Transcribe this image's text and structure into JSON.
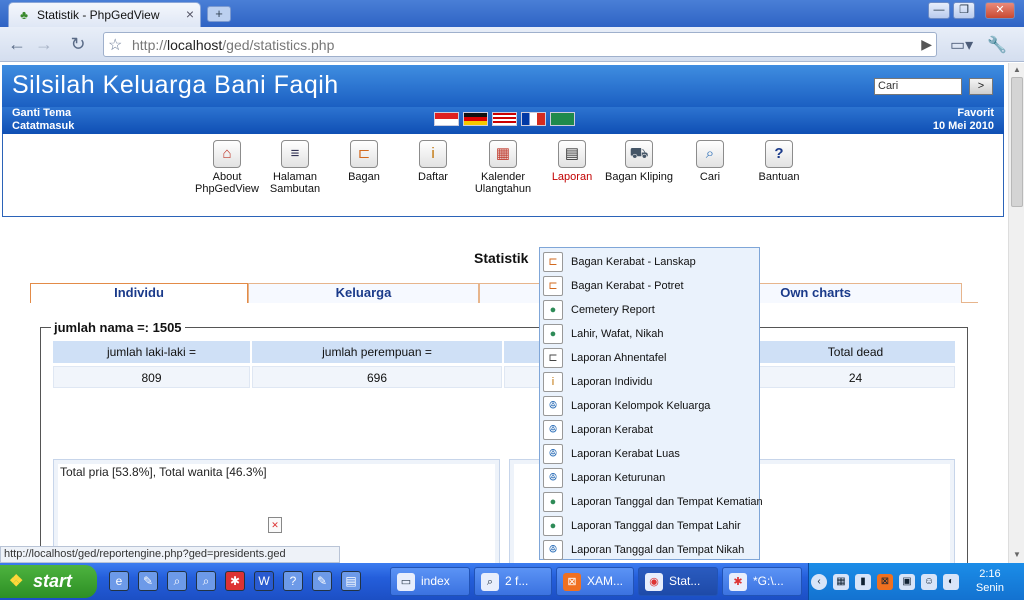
{
  "browser": {
    "tab_title": "Statistik - PhpGedView",
    "url_prefix": "http://",
    "url_host": "localhost",
    "url_path": "/ged/statistics.php",
    "tab_close": "×",
    "new_tab": "+",
    "win_min": "—",
    "win_max": "❐",
    "win_close": "✕"
  },
  "site": {
    "title": "Silsilah Keluarga Bani Faqih",
    "search_placeholder": "Cari",
    "search_button": ">",
    "left_links": [
      "Ganti Tema",
      "Catatmasuk"
    ],
    "right_links": [
      "Favorit",
      "10 Mei 2010"
    ]
  },
  "menu": [
    {
      "label1": "About",
      "label2": "PhpGedView",
      "icon": "⌂"
    },
    {
      "label1": "Halaman",
      "label2": "Sambutan",
      "icon": "≡"
    },
    {
      "label1": "Bagan",
      "label2": "",
      "icon": "⊏"
    },
    {
      "label1": "Daftar",
      "label2": "",
      "icon": "i"
    },
    {
      "label1": "Kalender",
      "label2": "Ulangtahun",
      "icon": "▦"
    },
    {
      "label1": "Laporan",
      "label2": "",
      "icon": "▤"
    },
    {
      "label1": "Bagan Kliping",
      "label2": "",
      "icon": "⛟"
    },
    {
      "label1": "Cari",
      "label2": "",
      "icon": "⌕"
    },
    {
      "label1": "Bantuan",
      "label2": "",
      "icon": "?"
    }
  ],
  "page": {
    "heading": "Statistik",
    "tabs": [
      "Individu",
      "Keluarga",
      "Own charts"
    ],
    "legend": "jumlah nama =: 1505",
    "headers": [
      "jumlah laki-laki =",
      "jumlah perempuan =",
      "Total dead"
    ],
    "values": [
      "809",
      "696",
      "24"
    ],
    "chart_text": "Total pria [53.8%], Total wanita [46.3%]",
    "status_url": "http://localhost/ged/reportengine.php?ged=presidents.ged"
  },
  "dropdown": [
    {
      "label": "Bagan Kerabat - Lanskap",
      "icon": "⊏",
      "color": "#d2691e"
    },
    {
      "label": "Bagan Kerabat - Potret",
      "icon": "⊏",
      "color": "#d2691e"
    },
    {
      "label": "Cemetery Report",
      "icon": "●",
      "color": "#2e8b57"
    },
    {
      "label": "Lahir, Wafat, Nikah",
      "icon": "●",
      "color": "#2e8b57"
    },
    {
      "label": "Laporan Ahnentafel",
      "icon": "⊏",
      "color": "#444"
    },
    {
      "label": "Laporan Individu",
      "icon": "i",
      "color": "#c07000"
    },
    {
      "label": "Laporan Kelompok Keluarga",
      "icon": "ꔮ",
      "color": "#2d6fb8"
    },
    {
      "label": "Laporan Kerabat",
      "icon": "ꔮ",
      "color": "#2d6fb8"
    },
    {
      "label": "Laporan Kerabat Luas",
      "icon": "ꔮ",
      "color": "#2d6fb8"
    },
    {
      "label": "Laporan Keturunan",
      "icon": "ꔮ",
      "color": "#2d6fb8"
    },
    {
      "label": "Laporan Tanggal dan Tempat Kematian",
      "icon": "●",
      "color": "#2e8b57"
    },
    {
      "label": "Laporan Tanggal dan Tempat Lahir",
      "icon": "●",
      "color": "#2e8b57"
    },
    {
      "label": "Laporan Tanggal dan Tempat Nikah",
      "icon": "ꔮ",
      "color": "#2d6fb8"
    }
  ],
  "taskbar": {
    "start": "start",
    "tasks": [
      "index",
      "2 f...",
      "XAM...",
      "Stat...",
      "*G:\\..."
    ],
    "time": "2:16",
    "day": "Senin"
  }
}
